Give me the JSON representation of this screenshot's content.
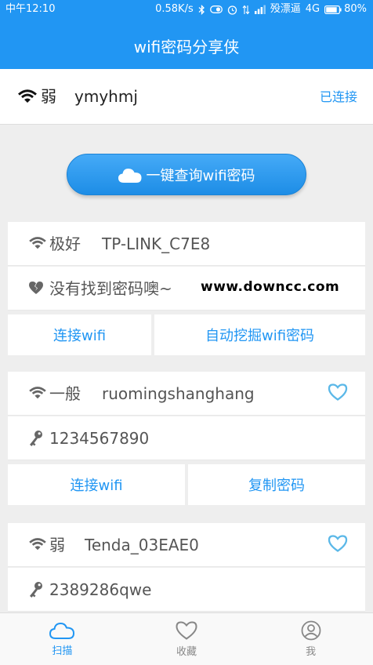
{
  "status_bar": {
    "time": "中午12:10",
    "speed": "0.58K/s",
    "carrier": "殁漂逼",
    "network": "4G",
    "battery": "80%"
  },
  "header": {
    "title": "wifi密码分享侠"
  },
  "connected": {
    "strength": "弱",
    "ssid": "ymyhmj",
    "status": "已连接",
    "icon": "wifi-icon"
  },
  "query_button": {
    "label": "一键查询wifi密码",
    "icon": "cloud-icon"
  },
  "watermark": "www.downcc.com",
  "networks": [
    {
      "strength": "极好",
      "ssid": "TP-LINK_C7E8",
      "detail": "没有找到密码噢~",
      "detail_icon": "broken-heart-icon",
      "actions": [
        "连接wifi",
        "自动挖掘wifi密码"
      ]
    },
    {
      "strength": "一般",
      "ssid": "ruomingshanghang",
      "detail": "1234567890",
      "detail_icon": "key-icon",
      "actions": [
        "连接wifi",
        "复制密码"
      ]
    },
    {
      "strength": "弱",
      "ssid": "Tenda_03EAE0",
      "detail": "2389286qwe",
      "detail_icon": "key-icon"
    }
  ],
  "bottom_nav": [
    {
      "label": "扫描",
      "icon": "cloud-icon",
      "active": true
    },
    {
      "label": "收藏",
      "icon": "heart-icon",
      "active": false
    },
    {
      "label": "我",
      "icon": "user-icon",
      "active": false
    }
  ],
  "colors": {
    "primary": "#2196f3",
    "heart": "#5bb8e8",
    "background": "#eeeeee"
  }
}
